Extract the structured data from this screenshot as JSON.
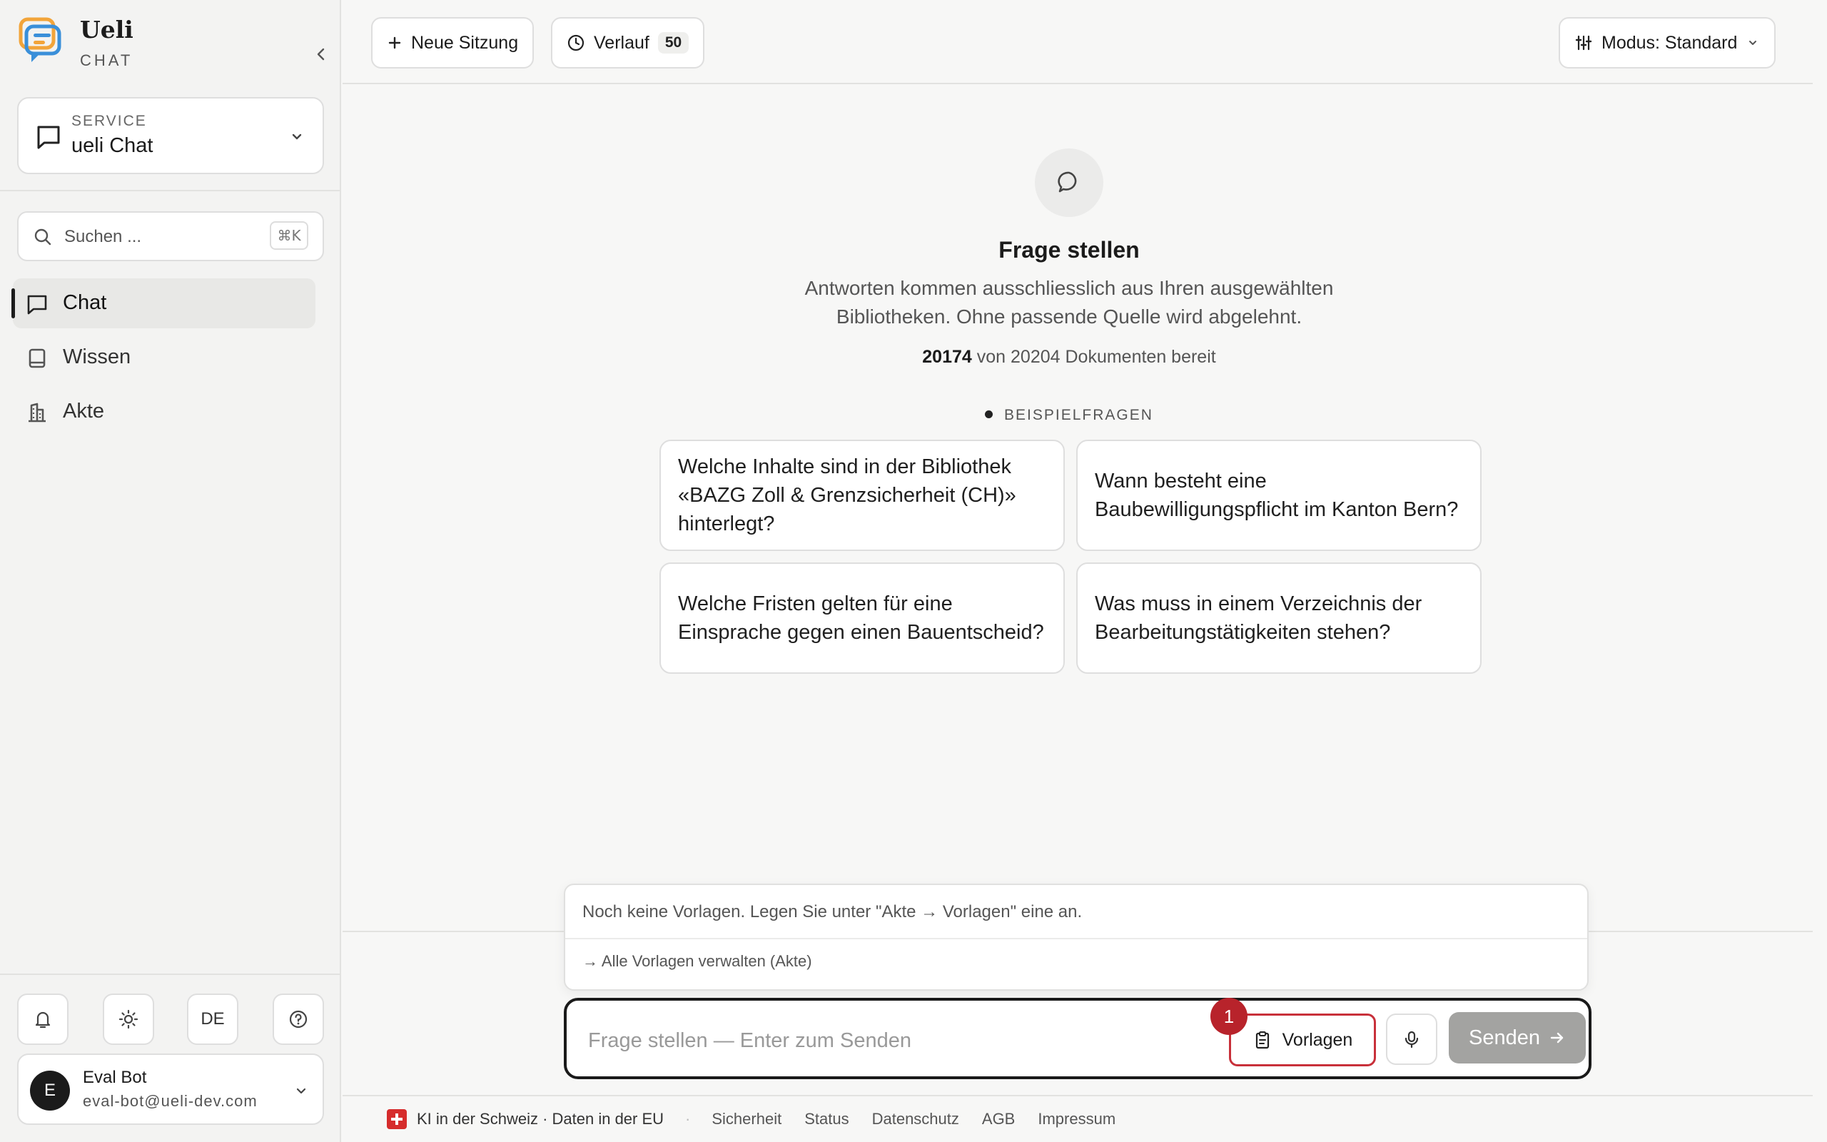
{
  "app": {
    "name": "Ueli",
    "subtitle": "CHAT"
  },
  "service": {
    "label": "SERVICE",
    "value": "ueli Chat"
  },
  "search": {
    "placeholder": "Suchen ...",
    "shortcut": "⌘K"
  },
  "nav": [
    {
      "label": "Chat",
      "icon": "chat-bubble-icon",
      "active": true
    },
    {
      "label": "Wissen",
      "icon": "book-icon",
      "active": false
    },
    {
      "label": "Akte",
      "icon": "building-icon",
      "active": false
    }
  ],
  "utility": {
    "language": "DE"
  },
  "user": {
    "initial": "E",
    "name": "Eval Bot",
    "email": "eval-bot@ueli-dev.com"
  },
  "topbar": {
    "new_session": "Neue Sitzung",
    "history": "Verlauf",
    "history_count": "50",
    "mode": "Modus: Standard"
  },
  "hero": {
    "title": "Frage stellen",
    "subtitle_line1": "Antworten kommen ausschliesslich aus Ihren ausgewählten",
    "subtitle_line2": "Bibliotheken. Ohne passende Quelle wird abgelehnt.",
    "docs_ready": "20174",
    "docs_text": "von 20204 Dokumenten bereit"
  },
  "examples": {
    "label": "BEISPIELFRAGEN",
    "questions": [
      "Welche Inhalte sind in der Bibliothek «BAZG Zoll & Grenzsicherheit (CH)» hinterlegt?",
      "Wann besteht eine Baubewilligungspflicht im Kanton Bern?",
      "Welche Fristen gelten für eine Einsprache gegen einen Bauentscheid?",
      "Was muss in einem Verzeichnis der Bearbeitungstätigkeiten stehen?"
    ]
  },
  "templates_popup": {
    "empty_text": "Noch keine Vorlagen. Legen Sie unter \"Akte → Vorlagen\" eine an.",
    "manage_link": "→ Alle Vorlagen verwalten (Akte)"
  },
  "composer": {
    "placeholder": "Frage stellen — Enter zum Senden",
    "templates_button": "Vorlagen",
    "templates_badge": "1",
    "send_button": "Senden"
  },
  "footer": {
    "region": "KI in der Schweiz · Daten in der EU",
    "separator": "·",
    "links": [
      "Sicherheit",
      "Status",
      "Datenschutz",
      "AGB",
      "Impressum"
    ]
  },
  "colors": {
    "accent_red": "#b8232b",
    "send_disabled": "#a3a3a1",
    "border": "#dedede"
  }
}
